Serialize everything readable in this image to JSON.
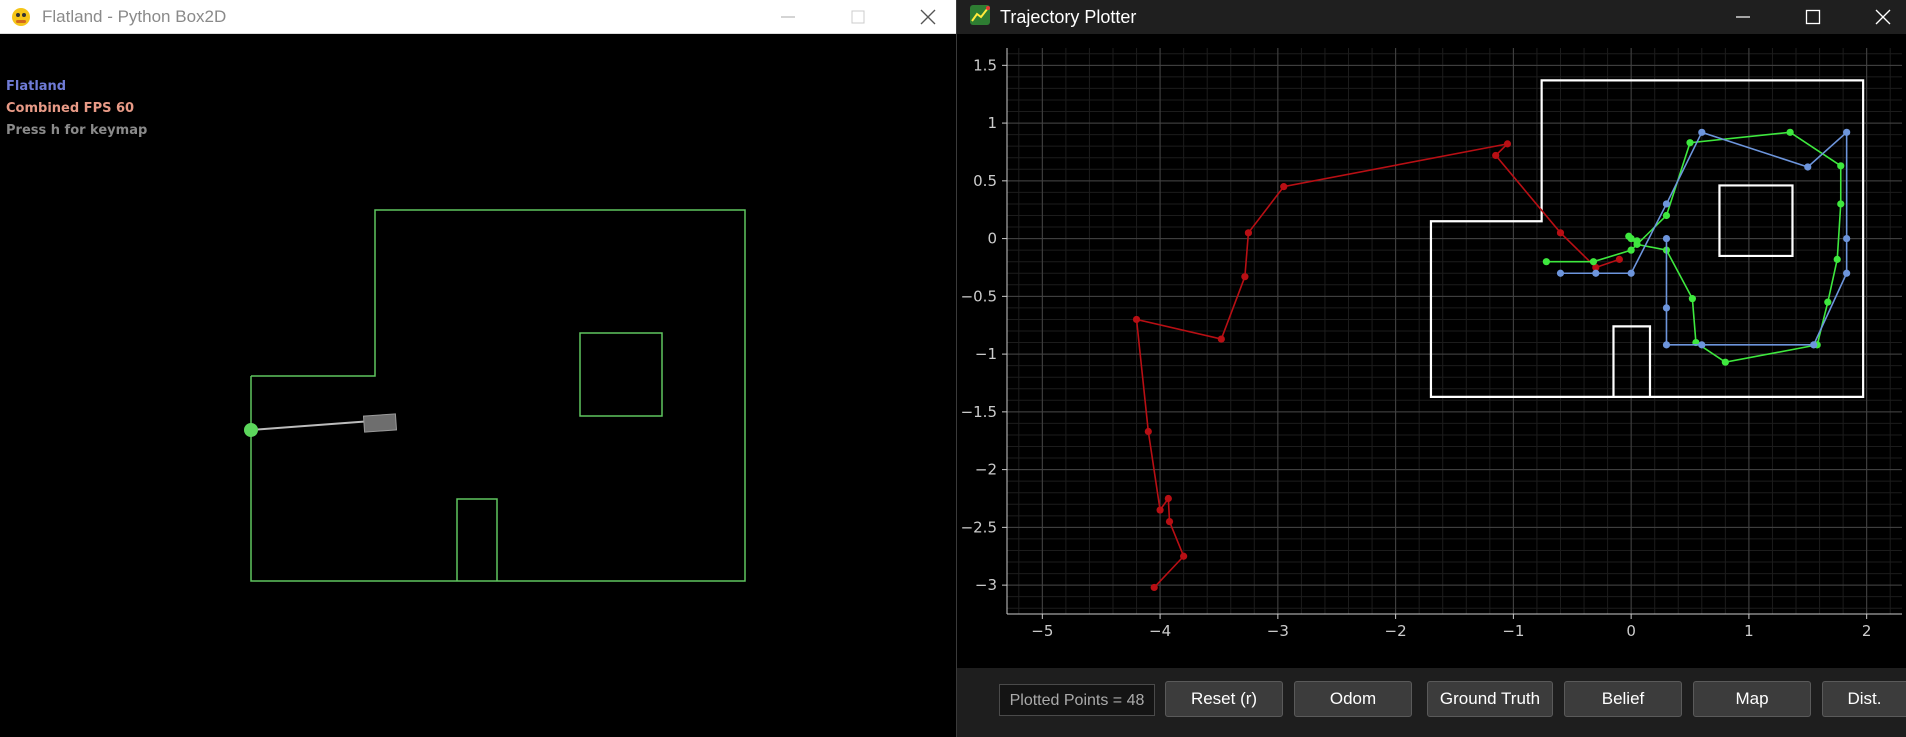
{
  "left_window": {
    "title": "Flatland - Python Box2D",
    "hud": {
      "line1": "Flatland",
      "line2": "Combined FPS 60",
      "line3": "Press h for keymap"
    },
    "colors": {
      "walls": "#5fc65f",
      "robot": "#5cd65c",
      "hud_title": "#6f7bd6",
      "hud_fps": "#e89a86",
      "hud_help": "#8a8a8a"
    }
  },
  "right_window": {
    "title": "Trajectory Plotter",
    "x_ticks": [
      "-5",
      "-4",
      "-3",
      "-2",
      "-1",
      "0",
      "1",
      "2"
    ],
    "y_ticks": [
      "1.5",
      "1",
      "0.5",
      "0",
      "-0.5",
      "-1",
      "-1.5",
      "-2",
      "-2.5",
      "-3"
    ],
    "plotted_points_label": "Plotted Points = 48",
    "buttons": {
      "reset": "Reset (r)",
      "odom": "Odom",
      "ground_truth": "Ground Truth",
      "belief": "Belief",
      "map": "Map",
      "dist": "Dist."
    },
    "colors": {
      "odom": "#b80f14",
      "ground_truth": "#3ee83e",
      "belief": "#6d95dc",
      "map": "#ffffff"
    }
  },
  "chart_data": {
    "type": "line",
    "title": "",
    "xlabel": "",
    "ylabel": "",
    "xlim": [
      -5.3,
      2.3
    ],
    "ylim": [
      -3.25,
      1.65
    ],
    "grid": true,
    "series": [
      {
        "key": "odom",
        "x": [
          -0.1,
          -0.3,
          -0.6,
          -1.15,
          -1.05,
          -2.95,
          -3.25,
          -3.28,
          -3.48,
          -4.2,
          -4.1,
          -4.0,
          -3.93,
          -3.92,
          -3.8,
          -4.05
        ],
        "y": [
          -0.18,
          -0.25,
          0.05,
          0.72,
          0.82,
          0.45,
          0.05,
          -0.33,
          -0.87,
          -0.7,
          -1.67,
          -2.35,
          -2.25,
          -2.45,
          -2.75,
          -3.02
        ]
      },
      {
        "key": "ground_truth",
        "x": [
          -0.72,
          -0.32,
          0.0,
          0.3,
          0.5,
          1.35,
          1.78,
          1.78,
          1.75,
          1.67,
          1.58,
          0.8,
          0.55,
          0.52,
          0.3,
          0.05,
          -0.02,
          0.0,
          0.05
        ],
        "y": [
          -0.2,
          -0.2,
          -0.1,
          0.2,
          0.83,
          0.92,
          0.63,
          0.3,
          -0.18,
          -0.55,
          -0.92,
          -1.07,
          -0.9,
          -0.52,
          -0.1,
          -0.05,
          0.02,
          0.0,
          -0.02
        ]
      },
      {
        "key": "belief",
        "x": [
          -0.6,
          -0.3,
          0.0,
          0.3,
          0.6,
          1.5,
          1.83,
          1.83,
          1.83,
          1.55,
          0.6,
          0.3,
          0.3,
          0.3
        ],
        "y": [
          -0.3,
          -0.3,
          -0.3,
          0.3,
          0.92,
          0.62,
          0.92,
          0.0,
          -0.3,
          -0.92,
          -0.92,
          -0.92,
          -0.6,
          0.0
        ]
      }
    ],
    "map": {
      "outer": [
        [
          -1.7,
          -1.37
        ],
        [
          1.97,
          -1.37
        ],
        [
          1.97,
          1.37
        ],
        [
          -0.76,
          1.37
        ],
        [
          -0.76,
          0.15
        ],
        [
          -1.7,
          0.15
        ]
      ],
      "box": [
        [
          0.75,
          -0.15
        ],
        [
          1.37,
          -0.15
        ],
        [
          1.37,
          0.46
        ],
        [
          0.75,
          0.46
        ]
      ],
      "door": [
        [
          -0.15,
          -1.37
        ],
        [
          -0.15,
          -0.76
        ],
        [
          0.16,
          -0.76
        ],
        [
          0.16,
          -1.37
        ]
      ]
    }
  }
}
